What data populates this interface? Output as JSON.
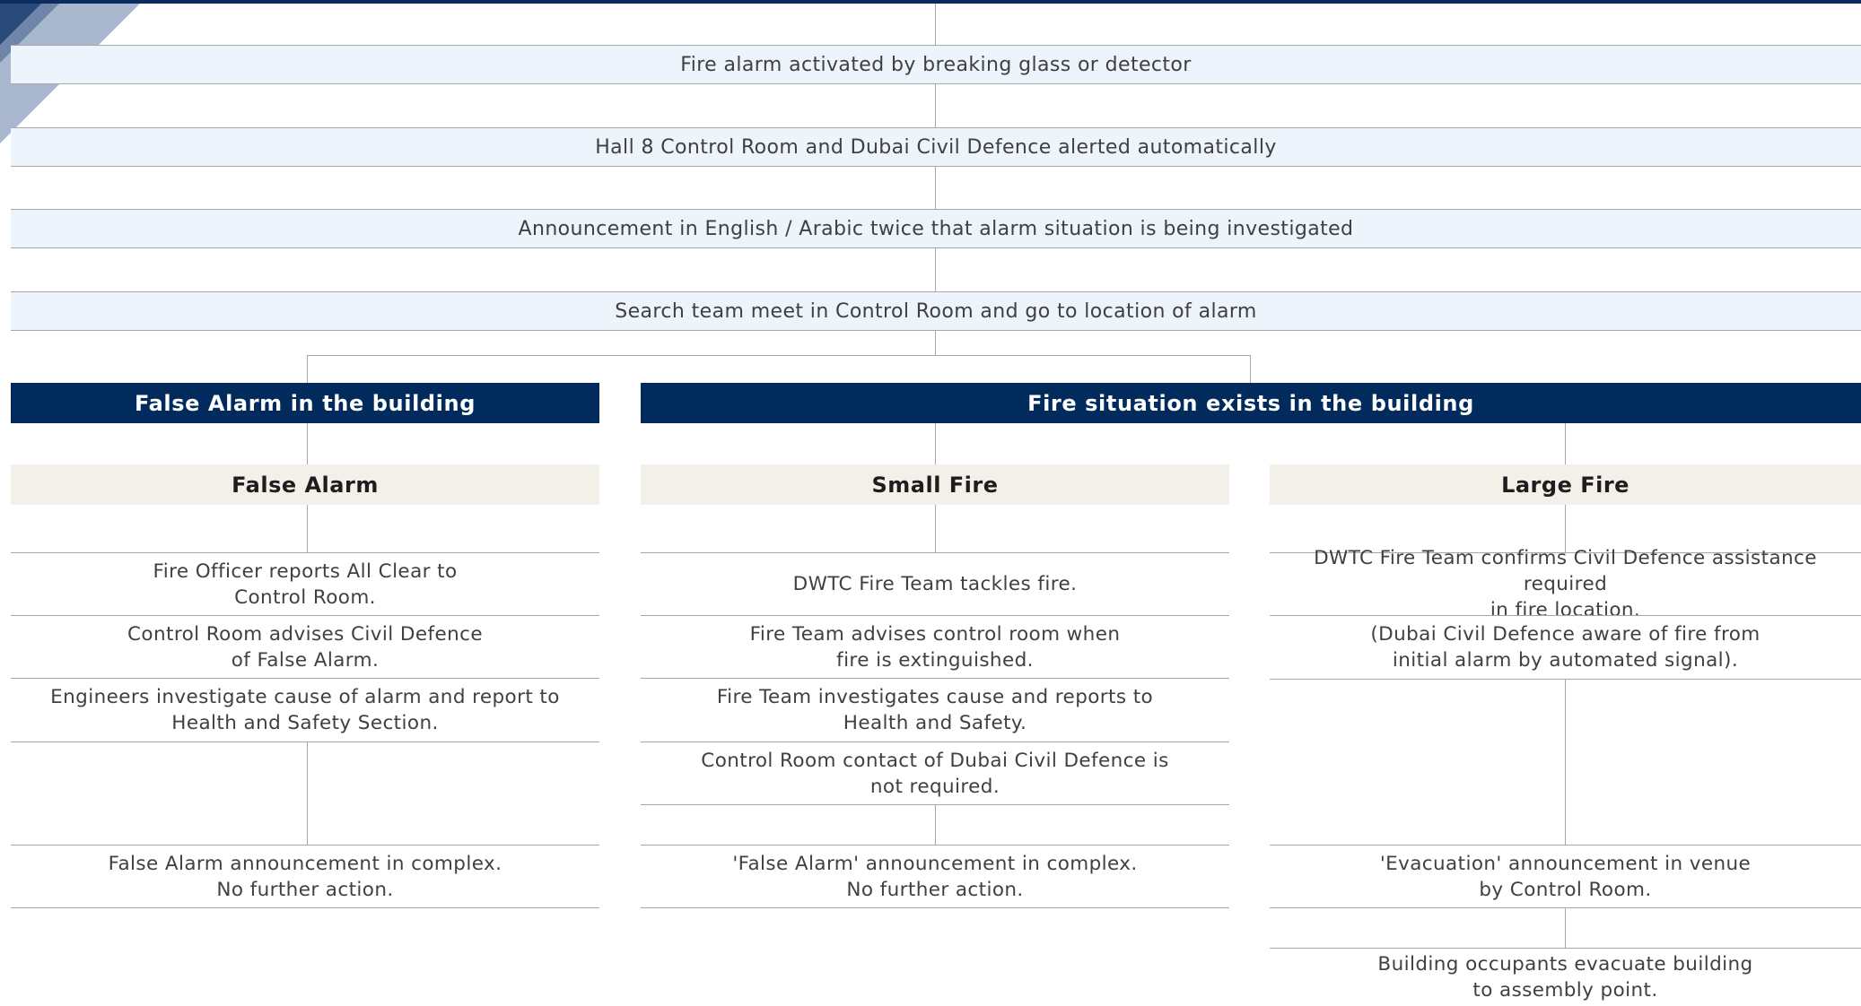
{
  "steps": [
    "Fire alarm activated by breaking glass or detector",
    "Hall 8 Control Room and Dubai Civil Defence alerted automatically",
    "Announcement in English / Arabic twice that alarm situation is being investigated",
    "Search team meet in Control Room and go to location of alarm"
  ],
  "outcomes": {
    "false_alarm_building": "False Alarm in the building",
    "fire_situation": "Fire situation exists in the building"
  },
  "categories": {
    "false_alarm": "False Alarm",
    "small_fire": "Small Fire",
    "large_fire": "Large Fire"
  },
  "false_alarm_steps": [
    "Fire Officer reports All Clear to\nControl Room.",
    "Control Room advises Civil Defence\nof False Alarm.",
    "Engineers investigate cause of alarm and report to\nHealth and Safety Section.",
    "False Alarm announcement in complex.\nNo further action."
  ],
  "small_fire_steps": [
    "DWTC Fire Team tackles fire.",
    "Fire Team advises control room when\nfire is extinguished.",
    "Fire Team investigates cause and reports to\nHealth and Safety.",
    "Control Room contact of Dubai Civil Defence is\nnot required.",
    "'False Alarm' announcement in complex.\nNo further action."
  ],
  "large_fire_steps": [
    "DWTC Fire Team confirms Civil Defence assistance required\nin fire location.",
    "(Dubai Civil Defence aware of fire from\ninitial alarm by automated signal).",
    "'Evacuation' announcement in venue\nby Control Room.",
    "Building occupants evacuate building\nto assembly point."
  ],
  "colors": {
    "navy": "#002b5c",
    "step_fill": "#edf4fb",
    "category_fill": "#f3f0ea",
    "line": "#a7a7a7"
  }
}
